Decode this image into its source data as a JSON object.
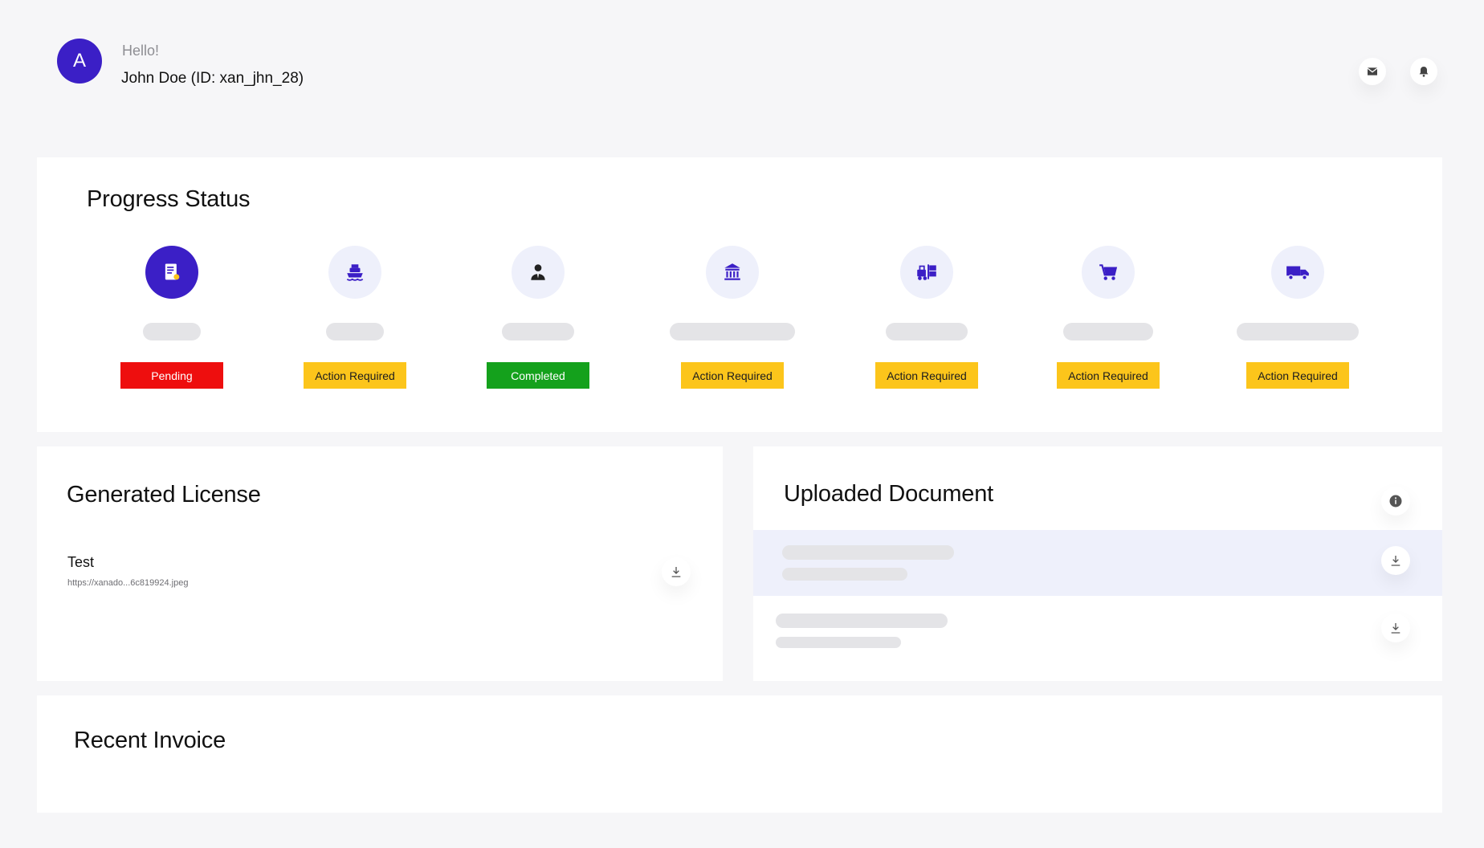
{
  "header": {
    "avatar_letter": "A",
    "greeting": "Hello!",
    "user_line": "John Doe (ID: xan_jhn_28)",
    "icons": [
      "mail-icon",
      "bell-icon"
    ]
  },
  "progress": {
    "title": "Progress Status",
    "steps": [
      {
        "icon": "license-document-icon",
        "status": "Pending"
      },
      {
        "icon": "ship-icon",
        "status": "Action Required"
      },
      {
        "icon": "customs-agent-icon",
        "status": "Completed"
      },
      {
        "icon": "bank-icon",
        "status": "Action Required"
      },
      {
        "icon": "forklift-icon",
        "status": "Action Required"
      },
      {
        "icon": "cart-icon",
        "status": "Action Required"
      },
      {
        "icon": "truck-icon",
        "status": "Action Required"
      }
    ],
    "colors": {
      "accent": "#3b1fc6",
      "pending": "#ee0e0e",
      "action": "#fcc51b",
      "completed": "#14a11c"
    }
  },
  "license": {
    "title": "Generated License",
    "items": [
      {
        "name": "Test",
        "url": "https://xanado...6c819924.jpeg"
      }
    ]
  },
  "uploads": {
    "title": "Uploaded Document"
  },
  "invoice": {
    "title": "Recent Invoice"
  }
}
